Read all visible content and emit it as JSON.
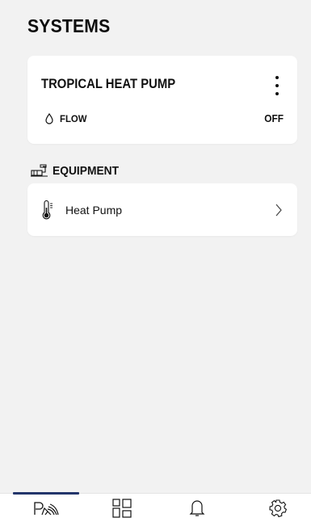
{
  "page": {
    "title": "SYSTEMS"
  },
  "system_card": {
    "name": "TROPICAL HEAT PUMP",
    "menu_icon": "kebab-menu-icon",
    "flow": {
      "icon": "water-drop-icon",
      "label": "FLOW",
      "value": "OFF"
    }
  },
  "equipment_section": {
    "icon": "equipment-icon",
    "title": "EQUIPMENT",
    "items": [
      {
        "icon": "thermometer-icon",
        "label": "Heat Pump",
        "chevron": "chevron-right-icon"
      }
    ]
  },
  "tabbar": {
    "active_index": 0,
    "tabs": [
      {
        "icon": "pool-icon"
      },
      {
        "icon": "dashboard-icon"
      },
      {
        "icon": "bell-icon"
      },
      {
        "icon": "settings-gear-icon"
      }
    ]
  },
  "colors": {
    "background": "#f2f2f2",
    "card": "#ffffff",
    "text": "#111111",
    "tab_indicator": "#23356b"
  }
}
